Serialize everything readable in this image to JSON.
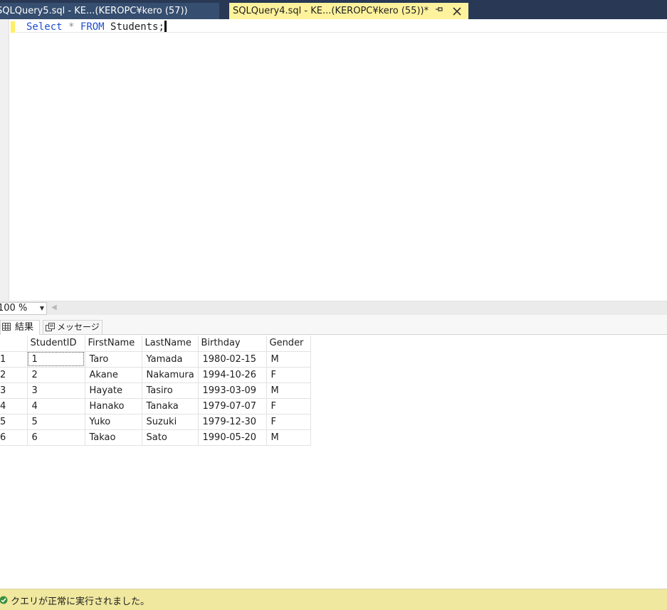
{
  "tabs": [
    {
      "label": "SQLQuery5.sql - KE...(KEROPC¥kero (57))",
      "active": false
    },
    {
      "label": "SQLQuery4.sql - KE...(KEROPC¥kero (55))*",
      "active": true
    }
  ],
  "tab_icons": {
    "pin": "pin-icon",
    "close": "close-icon"
  },
  "editor": {
    "tokens": {
      "select": "Select",
      "star": "*",
      "from": "FROM",
      "table": "Students;"
    }
  },
  "zoom": {
    "value": "100 %"
  },
  "result_tabs": {
    "results": "結果",
    "messages": "メッセージ"
  },
  "grid": {
    "columns": [
      "StudentID",
      "FirstName",
      "LastName",
      "Birthday",
      "Gender"
    ],
    "rows": [
      {
        "n": "1",
        "cells": [
          "1",
          "Taro",
          "Yamada",
          "1980-02-15",
          "M"
        ]
      },
      {
        "n": "2",
        "cells": [
          "2",
          "Akane",
          "Nakamura",
          "1994-10-26",
          "F"
        ]
      },
      {
        "n": "3",
        "cells": [
          "3",
          "Hayate",
          "Tasiro",
          "1993-03-09",
          "M"
        ]
      },
      {
        "n": "4",
        "cells": [
          "4",
          "Hanako",
          "Tanaka",
          "1979-07-07",
          "F"
        ]
      },
      {
        "n": "5",
        "cells": [
          "5",
          "Yuko",
          "Suzuki",
          "1979-12-30",
          "F"
        ]
      },
      {
        "n": "6",
        "cells": [
          "6",
          "Takao",
          "Sato",
          "1990-05-20",
          "M"
        ]
      }
    ]
  },
  "status": {
    "text": "クエリが正常に実行されました。",
    "icon": "success-check-icon"
  },
  "colors": {
    "tab_bar": "#293955",
    "active_tab": "#fff29d",
    "keyword": "#1f4fd0",
    "status_bar": "#f0e89f"
  }
}
